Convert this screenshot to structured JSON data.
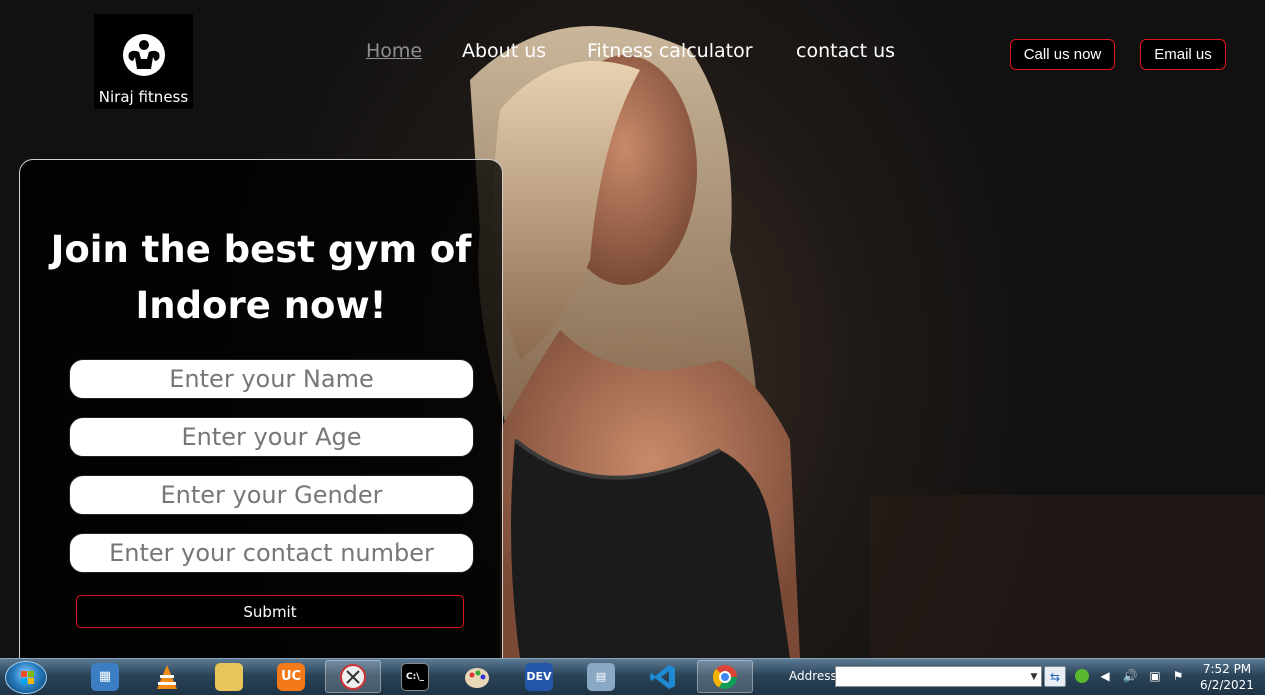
{
  "brand": {
    "name": "Niraj fitness",
    "logo_icon": "muscle-man-icon"
  },
  "nav": {
    "home": "Home",
    "about": "About us",
    "fitness": "Fitness calculator",
    "contact": "contact us"
  },
  "header_buttons": {
    "call": "Call us now",
    "email": "Email us"
  },
  "form": {
    "title_line1": "Join the best gym of",
    "title_line2": "Indore now!",
    "name_placeholder": "Enter your Name",
    "age_placeholder": "Enter your Age",
    "gender_placeholder": "Enter your Gender",
    "contact_placeholder": "Enter your contact number",
    "submit_label": "Submit"
  },
  "taskbar": {
    "items": [
      {
        "name": "control-panel-icon",
        "active": false
      },
      {
        "name": "vlc-icon",
        "active": false
      },
      {
        "name": "file-explorer-icon",
        "active": false
      },
      {
        "name": "uc-browser-icon",
        "active": false
      },
      {
        "name": "snipping-tool-icon",
        "active": true
      },
      {
        "name": "command-prompt-icon",
        "active": false
      },
      {
        "name": "paint-icon",
        "active": false
      },
      {
        "name": "dev-cpp-icon",
        "active": false
      },
      {
        "name": "calculator-icon",
        "active": false
      },
      {
        "name": "vscode-icon",
        "active": false
      },
      {
        "name": "chrome-icon",
        "active": true
      }
    ],
    "address_label": "Address",
    "address_value": "",
    "time": "7:52 PM",
    "date": "6/2/2021"
  },
  "colors": {
    "accent_border": "#e0141c",
    "card_bg": "#000000",
    "nav_active": "#8f8f8f"
  }
}
